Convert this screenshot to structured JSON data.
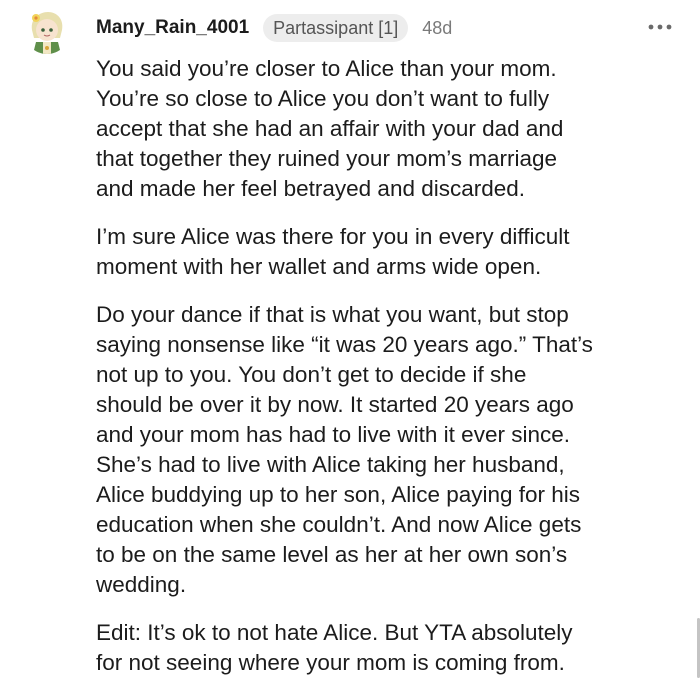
{
  "comment": {
    "username": "Many_Rain_4001",
    "flair": "Partassipant [1]",
    "age": "48d",
    "more_icon": "more-horizontal-icon",
    "avatar_icon": "user-avatar-icon",
    "paragraphs": [
      "You said you’re closer to Alice than your mom.\nYou’re so close to Alice you don’t want to fully\naccept that she had an affair with your dad and\nthat together they ruined your mom’s marriage\nand made her feel betrayed and discarded.",
      "I’m sure Alice was there for you in every difficult\nmoment with her wallet and arms wide open.",
      "Do your dance if that is what you want, but stop\nsaying nonsense like “it was 20 years ago.” That’s\nnot up to you. You don’t get to decide if she\nshould be over it by now. It started 20 years ago\nand your mom has had to live with it ever since.\nShe’s had to live with Alice taking her husband,\nAlice buddying up to her son, Alice paying for his\neducation when she couldn’t. And now Alice gets\nto be on the same level as her at her own son’s\nwedding.",
      "Edit: It’s ok to not hate Alice. But YTA absolutely\nfor not seeing where your mom is coming from."
    ]
  },
  "colors": {
    "text": "#1c1c1c",
    "flair_bg": "#ededed",
    "meta": "#7a7a7a"
  }
}
